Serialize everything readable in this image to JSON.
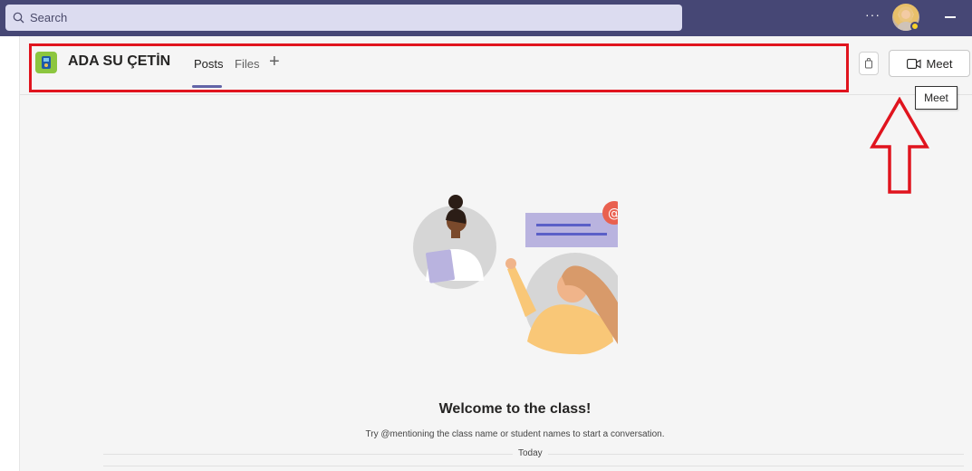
{
  "search": {
    "placeholder": "Search"
  },
  "topbar": {
    "more_label": "···"
  },
  "channel": {
    "team_name": "ADA SU ÇETİN",
    "tabs": [
      {
        "label": "Posts",
        "active": true
      },
      {
        "label": "Files",
        "active": false
      }
    ],
    "add_tab_label": "+"
  },
  "actions": {
    "meet_label": "Meet",
    "tooltip": "Meet"
  },
  "empty_state": {
    "title": "Welcome to the class!",
    "hint": "Try @mentioning the class name or student names to start a conversation.",
    "divider_label": "Today"
  },
  "colors": {
    "topbar": "#464775",
    "accent": "#6264a7",
    "annotation": "#e0141e",
    "team_logo": "#8cc63f"
  },
  "icons": {
    "search": "search-icon",
    "meet": "video-camera-icon",
    "info": "conversation-info-icon"
  }
}
